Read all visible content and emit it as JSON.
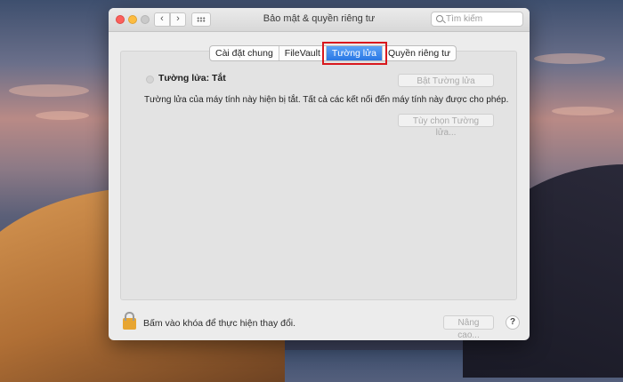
{
  "window": {
    "title": "Bảo mật & quyền riêng tư",
    "nav_back": "‹",
    "nav_forward": "›"
  },
  "search": {
    "placeholder": "Tìm kiếm"
  },
  "tabs": [
    {
      "label": "Cài đặt chung",
      "active": false
    },
    {
      "label": "FileVault",
      "active": false
    },
    {
      "label": "Tường lửa",
      "active": true
    },
    {
      "label": "Quyền riêng tư",
      "active": false
    }
  ],
  "firewall": {
    "status_label": "Tường lửa: Tắt",
    "description": "Tường lửa của máy tính này hiện bị tắt. Tất cả các kết nối đến máy tính này được cho phép.",
    "enable_button": "Bật Tường lửa",
    "options_button": "Tùy chọn Tường lửa..."
  },
  "footer": {
    "lock_text": "Bấm vào khóa để thực hiện thay đổi.",
    "advanced_button": "Nâng cao...",
    "help_button": "?"
  },
  "colors": {
    "active_tab": "#2a78e4",
    "highlight_box": "#d8181d",
    "lock": "#e7a531"
  }
}
